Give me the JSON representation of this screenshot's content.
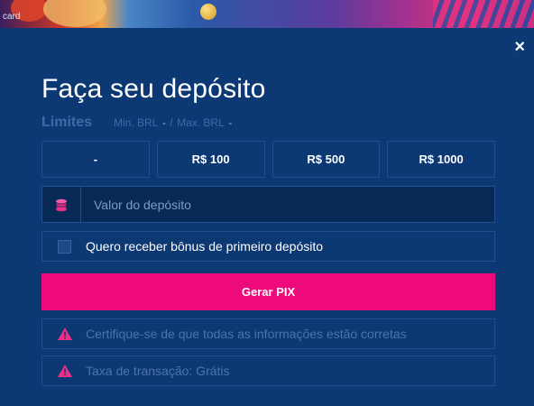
{
  "banner": {
    "label": "card"
  },
  "modal": {
    "close_label": "×",
    "title": "Faça seu depósito",
    "limits": {
      "label": "Limites",
      "min_label": "Min. BRL",
      "min_value": "-",
      "separator": "/",
      "max_label": "Max. BRL",
      "max_value": "-"
    },
    "amount_options": [
      "-",
      "R$ 100",
      "R$ 500",
      "R$ 1000"
    ],
    "deposit_field": {
      "placeholder": "Valor do depósito",
      "value": ""
    },
    "bonus_checkbox": {
      "label": "Quero receber bônus de primeiro depósito",
      "checked": false
    },
    "submit_label": "Gerar PIX",
    "notices": [
      "Certifique-se de que todas as informações estão corretas",
      "Taxa de transação: Grátis"
    ]
  },
  "colors": {
    "background": "#0c3874",
    "accent": "#ee0a7a",
    "border": "#1f4f8f",
    "muted_text": "#4c73aa"
  },
  "icons": [
    "coins-icon",
    "warning-icon",
    "close-icon",
    "checkbox-unchecked"
  ]
}
